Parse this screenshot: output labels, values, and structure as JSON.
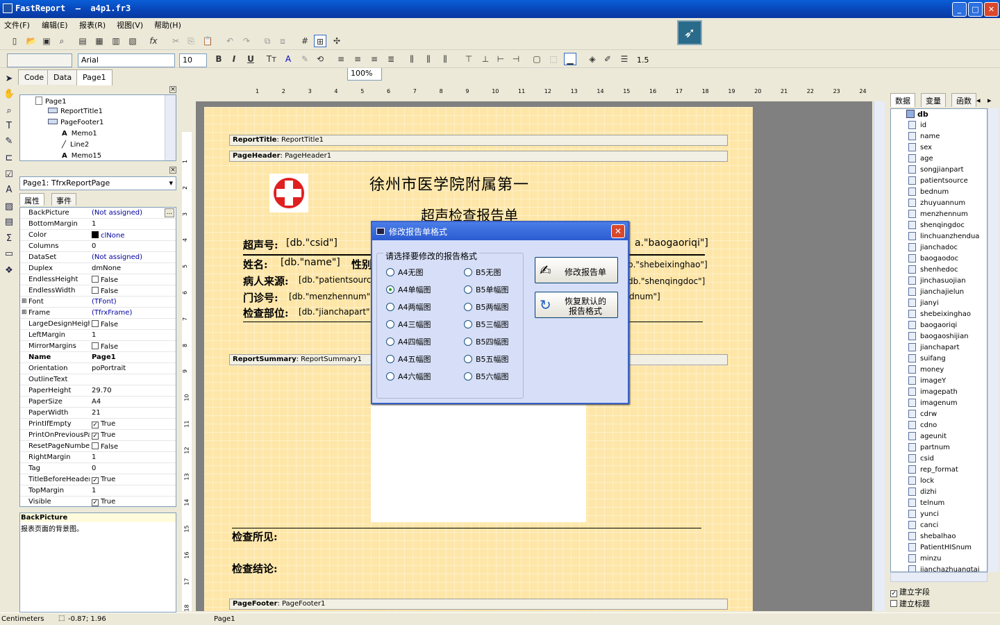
{
  "window": {
    "title": "FastReport  –  a4p1.fr3",
    "min": "_",
    "max": "□",
    "close": "✕"
  },
  "menu": [
    "文件(F)",
    "编辑(E)",
    "报表(R)",
    "视图(V)",
    "帮助(H)"
  ],
  "toolbar": {
    "zoom": "100%",
    "font_name": "Arial",
    "font_size": "10",
    "line_width": "1.5"
  },
  "tabs": [
    "Code",
    "Data",
    "Page1"
  ],
  "tree": [
    "Page1",
    "ReportTitle1",
    "PageFooter1",
    "Memo1",
    "Line2",
    "Memo15"
  ],
  "object_combo": "Page1: TfrxReportPage",
  "prop_tabs": [
    "属性",
    "事件"
  ],
  "props": [
    [
      "BackPicture",
      "(Not assigned)"
    ],
    [
      "BottomMargin",
      "1"
    ],
    [
      "Color",
      "clNone"
    ],
    [
      "Columns",
      "0"
    ],
    [
      "DataSet",
      "(Not assigned)"
    ],
    [
      "Duplex",
      "dmNone"
    ],
    [
      "EndlessHeight",
      "False"
    ],
    [
      "EndlessWidth",
      "False"
    ],
    [
      "Font",
      "(TFont)"
    ],
    [
      "Frame",
      "(TfrxFrame)"
    ],
    [
      "LargeDesignHeight",
      "False"
    ],
    [
      "LeftMargin",
      "1"
    ],
    [
      "MirrorMargins",
      "False"
    ],
    [
      "Name",
      "Page1"
    ],
    [
      "Orientation",
      "poPortrait"
    ],
    [
      "OutlineText",
      ""
    ],
    [
      "PaperHeight",
      "29.70"
    ],
    [
      "PaperSize",
      "A4"
    ],
    [
      "PaperWidth",
      "21"
    ],
    [
      "PrintIfEmpty",
      "True"
    ],
    [
      "PrintOnPreviousPa",
      "True"
    ],
    [
      "ResetPageNumber",
      "False"
    ],
    [
      "RightMargin",
      "1"
    ],
    [
      "Tag",
      "0"
    ],
    [
      "TitleBeforeHeader",
      "True"
    ],
    [
      "TopMargin",
      "1"
    ],
    [
      "Visible",
      "True"
    ]
  ],
  "help": {
    "title": "BackPicture",
    "desc": "报表页面的背景图。"
  },
  "ruler_top": [
    "1",
    "2",
    "3",
    "4",
    "5",
    "6",
    "7",
    "8",
    "9",
    "10",
    "11",
    "12",
    "13",
    "14",
    "15",
    "16",
    "17",
    "18",
    "19",
    "20",
    "21",
    "22",
    "23",
    "24"
  ],
  "ruler_left": [
    "1",
    "2",
    "3",
    "4",
    "5",
    "6",
    "7",
    "8",
    "9",
    "10",
    "11",
    "12",
    "13",
    "14",
    "15",
    "16",
    "17",
    "18"
  ],
  "report": {
    "band_title": "ReportTitle",
    "band_title_name": ": ReportTitle1",
    "band_header": "PageHeader",
    "band_header_name": ": PageHeader1",
    "band_summary": "ReportSummary",
    "band_summary_name": ": ReportSummary1",
    "band_footer": "PageFooter",
    "band_footer_name": ": PageFooter1",
    "hospital": "徐州市医学院附属第一",
    "subtitle": "超声检查报告单",
    "l_csid": "超声号:",
    "v_csid": "[db.\"csid\"]",
    "l_name": "姓名:",
    "v_name": "[db.\"name\"]",
    "l_sex": "性别",
    "l_src": "病人来源:",
    "v_src": "[db.\"patientsource",
    "l_mz": "门诊号:",
    "v_mz": "[db.\"menzhennum\"]",
    "l_part": "检查部位:",
    "v_part": "[db.\"jianchapart\"]",
    "v_date": "a.\"baogaoriqi\"]",
    "v_shebei": "b.\"shebeixinghao\"]",
    "v_shenqing": "db.\"shenqingdoc\"]",
    "v_dnum": "dnum\"]",
    "findings": "检查所见:",
    "conclusion": "检查结论:"
  },
  "dialog": {
    "title": "修改报告单格式",
    "group": "请选择要修改的报告格式",
    "a4": [
      "A4无图",
      "A4单幅图",
      "A4两幅图",
      "A4三幅图",
      "A4四幅图",
      "A4五幅图",
      "A4六幅图"
    ],
    "b5": [
      "B5无图",
      "B5单幅图",
      "B5两幅图",
      "B5三幅图",
      "B5四幅图",
      "B5五幅图",
      "B5六幅图"
    ],
    "selected": "A4单幅图",
    "btn_modify": "修改报告单",
    "btn_restore1": "恢复默认的",
    "btn_restore2": "报告格式"
  },
  "right_tabs": [
    "数据",
    "变量",
    "函数"
  ],
  "db_root": "db",
  "fields": [
    "id",
    "name",
    "sex",
    "age",
    "songjianpart",
    "patientsource",
    "bednum",
    "zhuyuannum",
    "menzhennum",
    "shenqingdoc",
    "linchuanzhendua",
    "jianchadoc",
    "baogaodoc",
    "shenhedoc",
    "jinchasuojian",
    "jianchajielun",
    "jianyi",
    "shebeixinghao",
    "baogaoriqi",
    "baogaoshijian",
    "jianchapart",
    "suifang",
    "money",
    "imageY",
    "imagepath",
    "imagenum",
    "cdrw",
    "cdno",
    "ageunit",
    "partnum",
    "csid",
    "rep_format",
    "lock",
    "dizhi",
    "telnum",
    "yunci",
    "canci",
    "shebalhao",
    "PatientHISnum",
    "minzu",
    "jianchazhuangtai"
  ],
  "checks": [
    {
      "label": "建立字段",
      "checked": true
    },
    {
      "label": "建立标题",
      "checked": false
    }
  ],
  "status": {
    "unit": "Centimeters",
    "coords": "-0.87; 1.96",
    "page": "Page1"
  },
  "colors": {
    "title_blue": "#0845b8",
    "page_yellow": "#fde6a8",
    "dialog_bg": "#d6dff7",
    "cross_red": "#e02020"
  }
}
